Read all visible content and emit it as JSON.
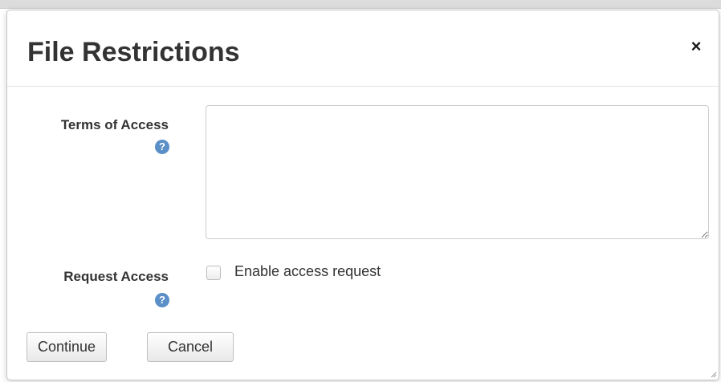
{
  "dialog": {
    "title": "File Restrictions",
    "close_symbol": "×",
    "close_icon": "close-icon"
  },
  "form": {
    "terms_of_access": {
      "label": "Terms of Access",
      "help_symbol": "?",
      "help_icon": "question-circle-icon",
      "value": "",
      "placeholder": ""
    },
    "request_access": {
      "label": "Request Access",
      "help_symbol": "?",
      "help_icon": "question-circle-icon",
      "checkbox_label": "Enable access request",
      "checked": false
    }
  },
  "footer": {
    "continue_label": "Continue",
    "cancel_label": "Cancel"
  },
  "colors": {
    "help_icon": "#5b8fc7",
    "text": "#333333",
    "border": "#cccccc"
  }
}
